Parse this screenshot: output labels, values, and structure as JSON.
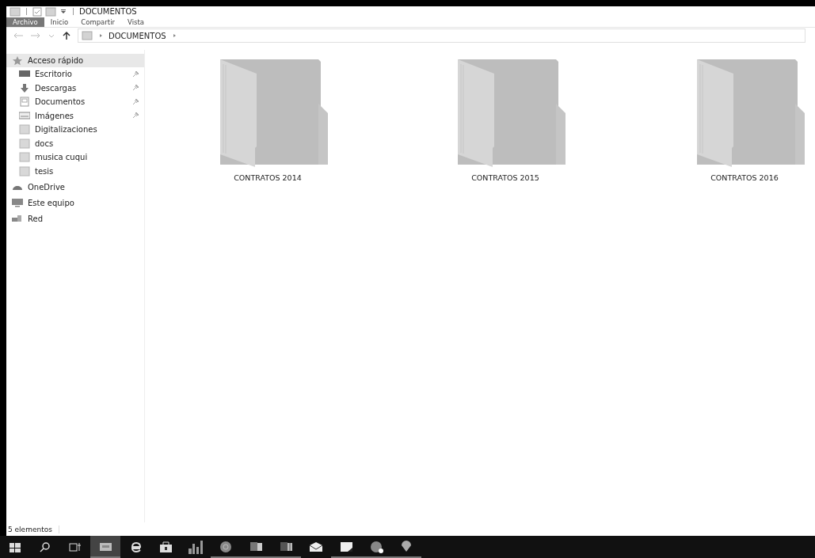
{
  "window": {
    "title": "DOCUMENTOS"
  },
  "ribbon_tabs": [
    {
      "label": "Archivo",
      "selected": true
    },
    {
      "label": "Inicio",
      "selected": false
    },
    {
      "label": "Compartir",
      "selected": false
    },
    {
      "label": "Vista",
      "selected": false
    }
  ],
  "address_bar": {
    "path": [
      "DOCUMENTOS"
    ]
  },
  "sidebar": {
    "items": [
      {
        "label": "Acceso rápido",
        "kind": "star",
        "selected": true,
        "children": [
          {
            "label": "Escritorio",
            "kind": "desktop",
            "pinned": true,
            "selected": false
          },
          {
            "label": "Descargas",
            "kind": "download",
            "pinned": true,
            "selected": false
          },
          {
            "label": "Documentos",
            "kind": "document",
            "pinned": true,
            "selected": false
          },
          {
            "label": "Imágenes",
            "kind": "image",
            "pinned": true,
            "selected": false
          },
          {
            "label": "Digitalizaciones",
            "kind": "folder",
            "pinned": false,
            "selected": false
          },
          {
            "label": "docs",
            "kind": "folder",
            "pinned": false,
            "selected": false
          },
          {
            "label": "musica cuqui",
            "kind": "folder",
            "pinned": false,
            "selected": false
          },
          {
            "label": "tesis",
            "kind": "folder",
            "pinned": false,
            "selected": false
          }
        ]
      },
      {
        "label": "OneDrive",
        "kind": "cloud",
        "selected": false
      },
      {
        "label": "Este equipo",
        "kind": "computer",
        "selected": false
      },
      {
        "label": "Red",
        "kind": "network",
        "selected": false
      }
    ]
  },
  "folders": [
    {
      "label": "CONTRATOS 2014"
    },
    {
      "label": "CONTRATOS 2015"
    },
    {
      "label": "CONTRATOS 2016"
    }
  ],
  "status_bar": {
    "text": "5 elementos"
  },
  "taskbar": [
    {
      "kind": "start",
      "running": false,
      "selected": false
    },
    {
      "kind": "search",
      "running": false,
      "selected": false
    },
    {
      "kind": "taskview",
      "running": false,
      "selected": false
    },
    {
      "kind": "explorer",
      "running": true,
      "selected": true
    },
    {
      "kind": "edge",
      "running": false,
      "selected": false
    },
    {
      "kind": "store",
      "running": false,
      "selected": false
    },
    {
      "kind": "equalizer",
      "running": false,
      "selected": false
    },
    {
      "kind": "circle",
      "running": true,
      "selected": false
    },
    {
      "kind": "word",
      "running": true,
      "selected": false
    },
    {
      "kind": "excel",
      "running": true,
      "selected": false
    },
    {
      "kind": "mail",
      "running": false,
      "selected": false
    },
    {
      "kind": "note",
      "running": true,
      "selected": false
    },
    {
      "kind": "chat",
      "running": true,
      "selected": false
    },
    {
      "kind": "balloon",
      "running": true,
      "selected": false
    }
  ]
}
